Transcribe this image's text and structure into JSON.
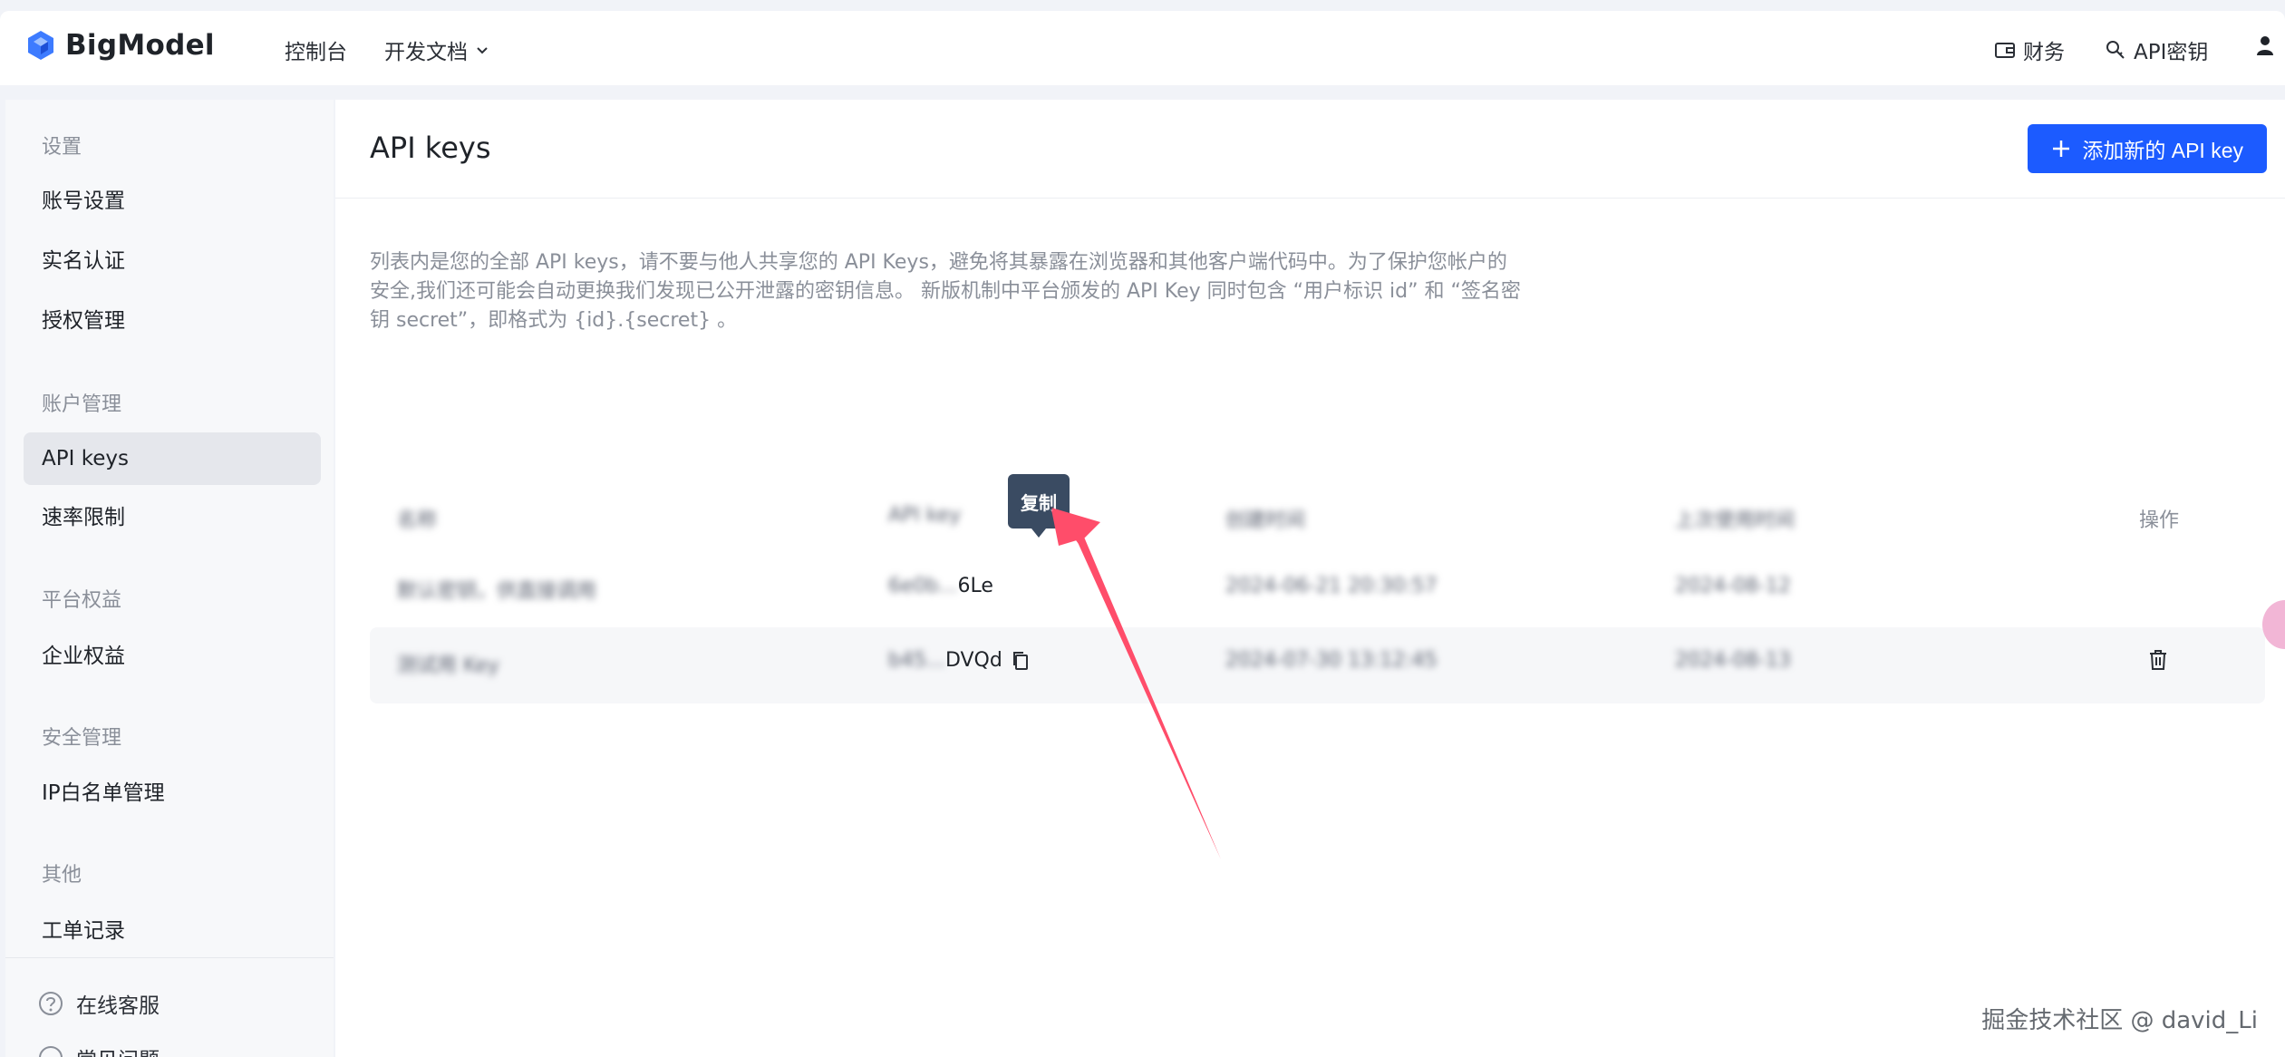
{
  "header": {
    "logo_text": "BigModel",
    "nav": [
      "控制台",
      "开发文档"
    ],
    "right": {
      "finance": "财务",
      "api_key": "API密钥"
    }
  },
  "sidebar": {
    "groups": [
      {
        "title": "设置",
        "items": [
          "账号设置",
          "实名认证",
          "授权管理"
        ]
      },
      {
        "title": "账户管理",
        "items": [
          "API keys",
          "速率限制"
        ]
      },
      {
        "title": "平台权益",
        "items": [
          "企业权益"
        ]
      },
      {
        "title": "安全管理",
        "items": [
          "IP白名单管理"
        ]
      },
      {
        "title": "其他",
        "items": [
          "工单记录"
        ]
      }
    ],
    "active": "API keys",
    "bottom": [
      "在线客服",
      "常见问题"
    ]
  },
  "main": {
    "title": "API keys",
    "add_button": "添加新的 API key",
    "description": "列表内是您的全部 API keys，请不要与他人共享您的 API Keys，避免将其暴露在浏览器和其他客户端代码中。为了保护您帐户的安全,我们还可能会自动更换我们发现已公开泄露的密钥信息。 新版机制中平台颁发的 API Key 同时包含 “用户标识 id” 和 “签名密钥 secret”，即格式为 {id}.{secret} 。",
    "table": {
      "headers": [
        "名称",
        "API key",
        "创建时间",
        "上次使用时间",
        "操作"
      ],
      "rows": [
        {
          "name": "默认密钥，供直接调用",
          "key": "6e0b...6Le",
          "created": "2024-06-21 20:30:57",
          "last_used": "2024-08-12"
        },
        {
          "name": "测试用 Key",
          "key": "b45...DVQd",
          "created": "2024-07-30 13:12:45",
          "last_used": "2024-08-13"
        }
      ]
    },
    "tooltip": "复制"
  },
  "watermark": "掘金技术社区 @ david_Li",
  "colors": {
    "accent": "#1c5bff",
    "annotation_arrow": "#ff4d6a"
  }
}
